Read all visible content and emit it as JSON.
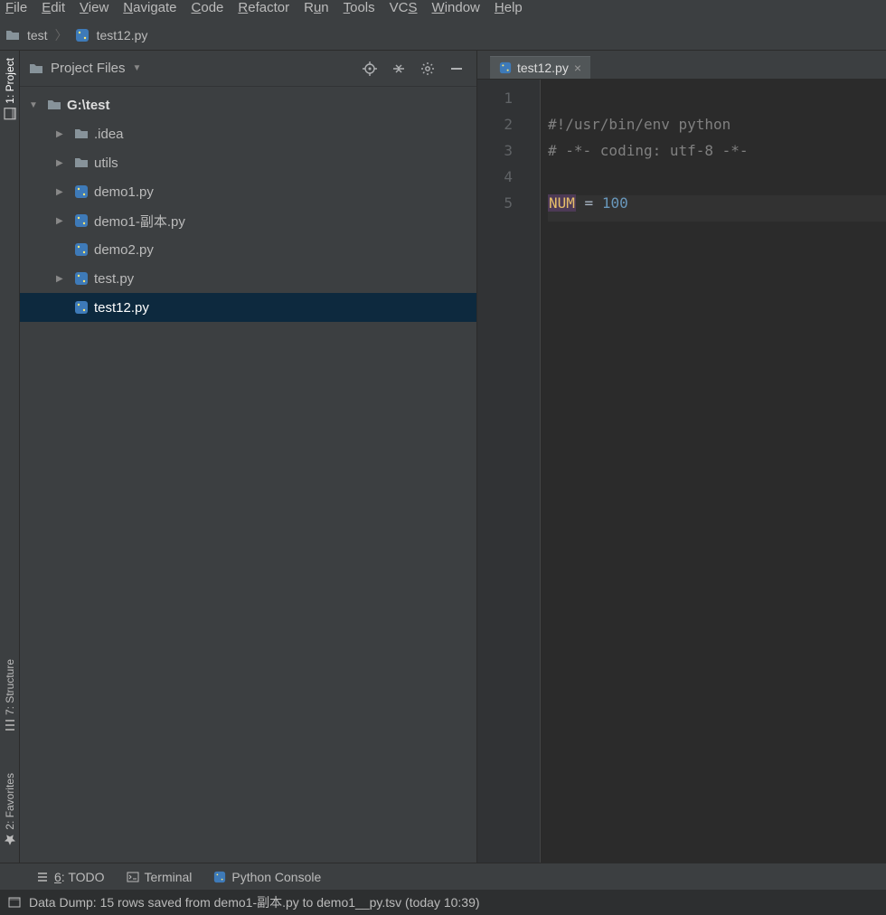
{
  "menubar": [
    "File",
    "Edit",
    "View",
    "Navigate",
    "Code",
    "Refactor",
    "Run",
    "Tools",
    "VCS",
    "Window",
    "Help"
  ],
  "breadcrumb": {
    "folder": "test",
    "file": "test12.py"
  },
  "left_rail": {
    "project": "1: Project",
    "structure": "7: Structure",
    "favorites": "2: Favorites"
  },
  "project_panel": {
    "title": "Project Files"
  },
  "tree": {
    "root": "G:\\test",
    "items": [
      {
        "name": ".idea",
        "type": "folder",
        "expandable": true
      },
      {
        "name": "utils",
        "type": "folder",
        "expandable": true
      },
      {
        "name": "demo1.py",
        "type": "py",
        "expandable": true
      },
      {
        "name": "demo1-副本.py",
        "type": "py",
        "expandable": true
      },
      {
        "name": "demo2.py",
        "type": "py",
        "expandable": false
      },
      {
        "name": "test.py",
        "type": "py",
        "expandable": true
      },
      {
        "name": "test12.py",
        "type": "py",
        "expandable": false,
        "selected": true
      }
    ]
  },
  "tabs": [
    {
      "name": "test12.py"
    }
  ],
  "code": {
    "lines": [
      "1",
      "2",
      "3",
      "4",
      "5"
    ],
    "l1_pre": "#!/usr/bin/env python",
    "l2_pre": "# -*- coding: utf-8 -*-",
    "l4_ident": "NUM",
    "l4_op": " = ",
    "l4_val": "100"
  },
  "bottombar": {
    "todo": "6: TODO",
    "terminal": "Terminal",
    "pyconsole": "Python Console"
  },
  "statusbar": {
    "msg": "Data Dump: 15 rows saved from demo1-副本.py to demo1__py.tsv (today 10:39)"
  }
}
